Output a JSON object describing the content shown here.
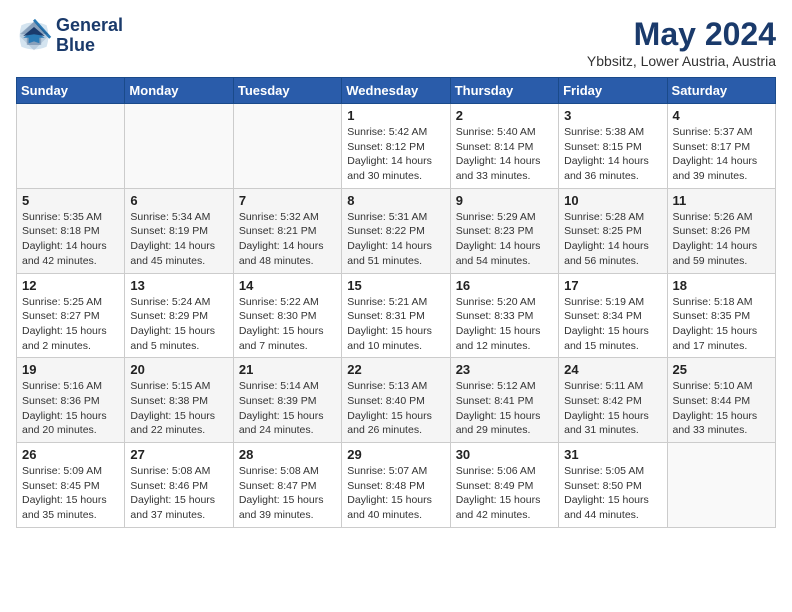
{
  "logo": {
    "line1": "General",
    "line2": "Blue"
  },
  "title": "May 2024",
  "location": "Ybbsitz, Lower Austria, Austria",
  "days_of_week": [
    "Sunday",
    "Monday",
    "Tuesday",
    "Wednesday",
    "Thursday",
    "Friday",
    "Saturday"
  ],
  "weeks": [
    [
      {
        "num": "",
        "info": ""
      },
      {
        "num": "",
        "info": ""
      },
      {
        "num": "",
        "info": ""
      },
      {
        "num": "1",
        "info": "Sunrise: 5:42 AM\nSunset: 8:12 PM\nDaylight: 14 hours\nand 30 minutes."
      },
      {
        "num": "2",
        "info": "Sunrise: 5:40 AM\nSunset: 8:14 PM\nDaylight: 14 hours\nand 33 minutes."
      },
      {
        "num": "3",
        "info": "Sunrise: 5:38 AM\nSunset: 8:15 PM\nDaylight: 14 hours\nand 36 minutes."
      },
      {
        "num": "4",
        "info": "Sunrise: 5:37 AM\nSunset: 8:17 PM\nDaylight: 14 hours\nand 39 minutes."
      }
    ],
    [
      {
        "num": "5",
        "info": "Sunrise: 5:35 AM\nSunset: 8:18 PM\nDaylight: 14 hours\nand 42 minutes."
      },
      {
        "num": "6",
        "info": "Sunrise: 5:34 AM\nSunset: 8:19 PM\nDaylight: 14 hours\nand 45 minutes."
      },
      {
        "num": "7",
        "info": "Sunrise: 5:32 AM\nSunset: 8:21 PM\nDaylight: 14 hours\nand 48 minutes."
      },
      {
        "num": "8",
        "info": "Sunrise: 5:31 AM\nSunset: 8:22 PM\nDaylight: 14 hours\nand 51 minutes."
      },
      {
        "num": "9",
        "info": "Sunrise: 5:29 AM\nSunset: 8:23 PM\nDaylight: 14 hours\nand 54 minutes."
      },
      {
        "num": "10",
        "info": "Sunrise: 5:28 AM\nSunset: 8:25 PM\nDaylight: 14 hours\nand 56 minutes."
      },
      {
        "num": "11",
        "info": "Sunrise: 5:26 AM\nSunset: 8:26 PM\nDaylight: 14 hours\nand 59 minutes."
      }
    ],
    [
      {
        "num": "12",
        "info": "Sunrise: 5:25 AM\nSunset: 8:27 PM\nDaylight: 15 hours\nand 2 minutes."
      },
      {
        "num": "13",
        "info": "Sunrise: 5:24 AM\nSunset: 8:29 PM\nDaylight: 15 hours\nand 5 minutes."
      },
      {
        "num": "14",
        "info": "Sunrise: 5:22 AM\nSunset: 8:30 PM\nDaylight: 15 hours\nand 7 minutes."
      },
      {
        "num": "15",
        "info": "Sunrise: 5:21 AM\nSunset: 8:31 PM\nDaylight: 15 hours\nand 10 minutes."
      },
      {
        "num": "16",
        "info": "Sunrise: 5:20 AM\nSunset: 8:33 PM\nDaylight: 15 hours\nand 12 minutes."
      },
      {
        "num": "17",
        "info": "Sunrise: 5:19 AM\nSunset: 8:34 PM\nDaylight: 15 hours\nand 15 minutes."
      },
      {
        "num": "18",
        "info": "Sunrise: 5:18 AM\nSunset: 8:35 PM\nDaylight: 15 hours\nand 17 minutes."
      }
    ],
    [
      {
        "num": "19",
        "info": "Sunrise: 5:16 AM\nSunset: 8:36 PM\nDaylight: 15 hours\nand 20 minutes."
      },
      {
        "num": "20",
        "info": "Sunrise: 5:15 AM\nSunset: 8:38 PM\nDaylight: 15 hours\nand 22 minutes."
      },
      {
        "num": "21",
        "info": "Sunrise: 5:14 AM\nSunset: 8:39 PM\nDaylight: 15 hours\nand 24 minutes."
      },
      {
        "num": "22",
        "info": "Sunrise: 5:13 AM\nSunset: 8:40 PM\nDaylight: 15 hours\nand 26 minutes."
      },
      {
        "num": "23",
        "info": "Sunrise: 5:12 AM\nSunset: 8:41 PM\nDaylight: 15 hours\nand 29 minutes."
      },
      {
        "num": "24",
        "info": "Sunrise: 5:11 AM\nSunset: 8:42 PM\nDaylight: 15 hours\nand 31 minutes."
      },
      {
        "num": "25",
        "info": "Sunrise: 5:10 AM\nSunset: 8:44 PM\nDaylight: 15 hours\nand 33 minutes."
      }
    ],
    [
      {
        "num": "26",
        "info": "Sunrise: 5:09 AM\nSunset: 8:45 PM\nDaylight: 15 hours\nand 35 minutes."
      },
      {
        "num": "27",
        "info": "Sunrise: 5:08 AM\nSunset: 8:46 PM\nDaylight: 15 hours\nand 37 minutes."
      },
      {
        "num": "28",
        "info": "Sunrise: 5:08 AM\nSunset: 8:47 PM\nDaylight: 15 hours\nand 39 minutes."
      },
      {
        "num": "29",
        "info": "Sunrise: 5:07 AM\nSunset: 8:48 PM\nDaylight: 15 hours\nand 40 minutes."
      },
      {
        "num": "30",
        "info": "Sunrise: 5:06 AM\nSunset: 8:49 PM\nDaylight: 15 hours\nand 42 minutes."
      },
      {
        "num": "31",
        "info": "Sunrise: 5:05 AM\nSunset: 8:50 PM\nDaylight: 15 hours\nand 44 minutes."
      },
      {
        "num": "",
        "info": ""
      }
    ]
  ]
}
